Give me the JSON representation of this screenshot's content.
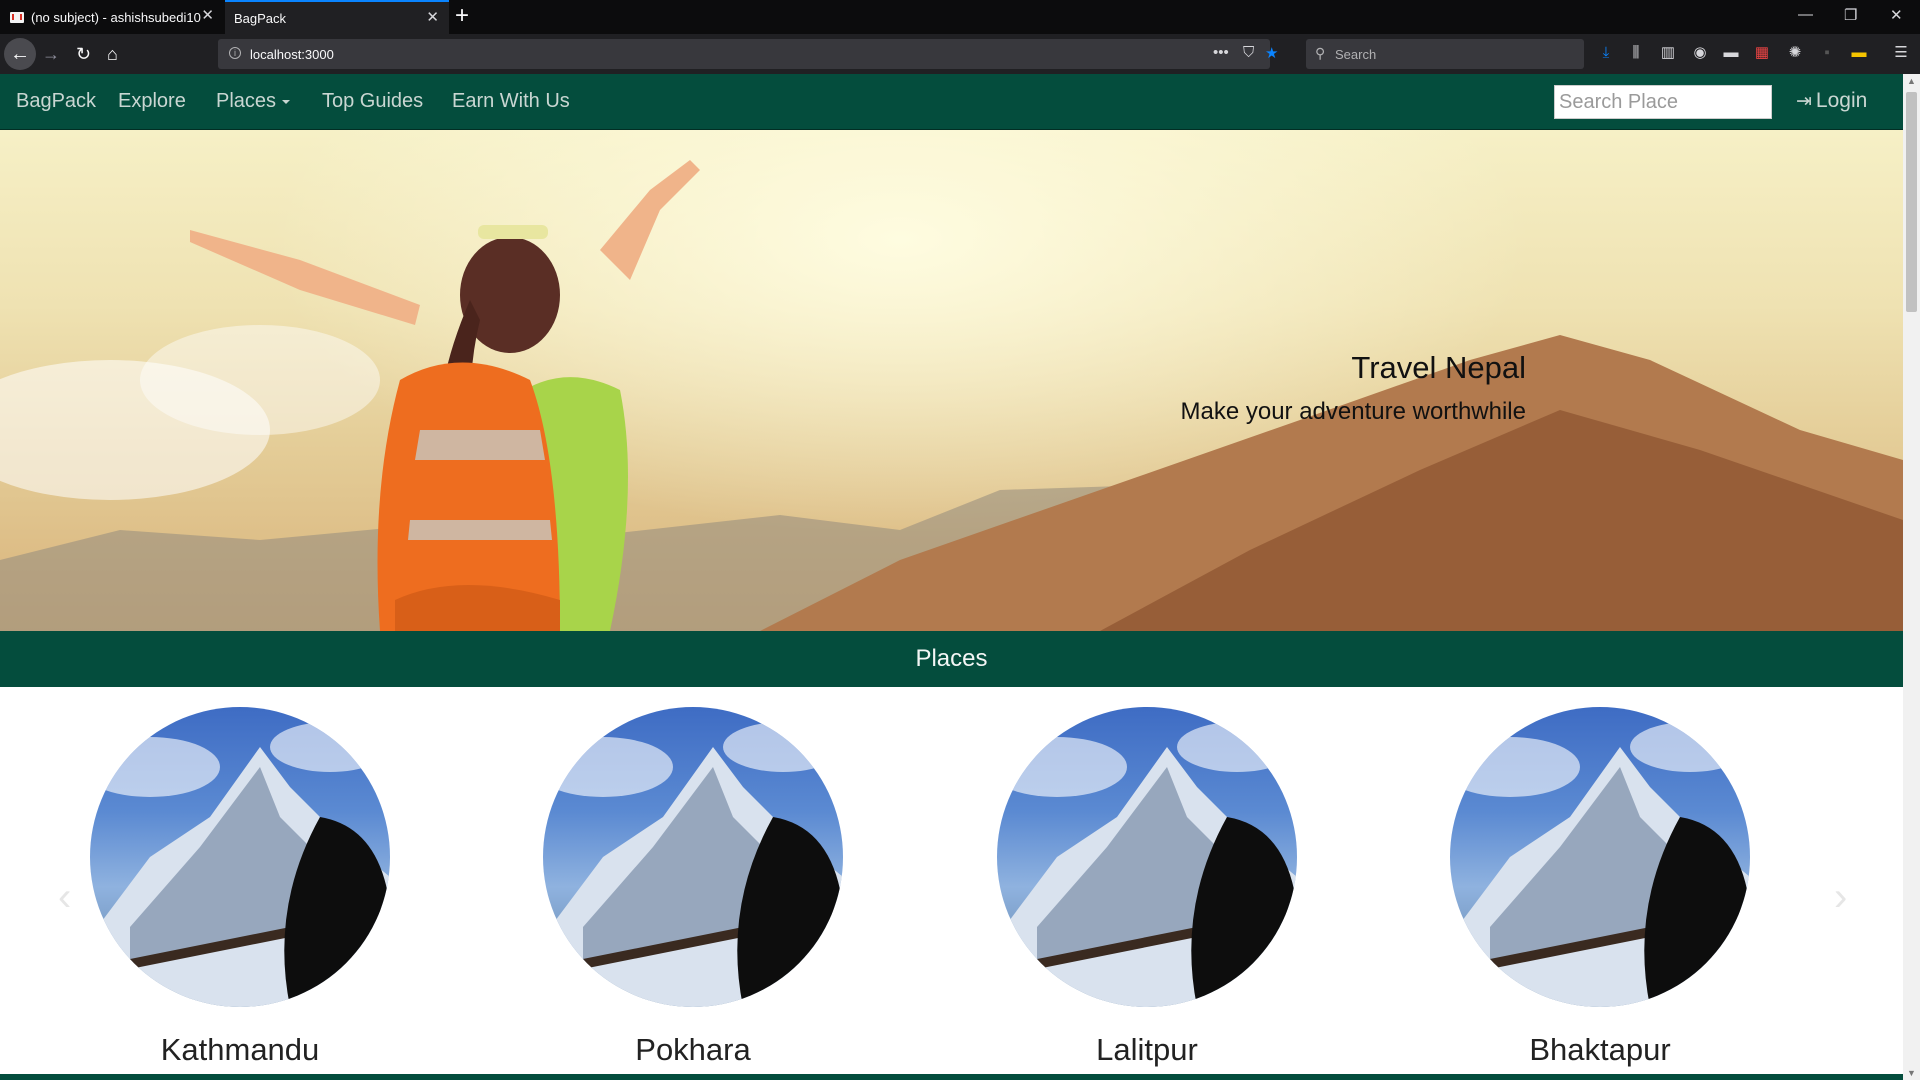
{
  "browser": {
    "tabs": [
      {
        "title": "(no subject) - ashishsubedi10@",
        "active": false
      },
      {
        "title": "BagPack",
        "active": true
      }
    ],
    "url": "localhost:3000",
    "search_placeholder": "Search"
  },
  "site": {
    "nav": {
      "brand": "BagPack",
      "links": [
        "Explore",
        "Places",
        "Top Guides",
        "Earn With Us"
      ],
      "search_placeholder": "Search Place",
      "login_label": "Login"
    },
    "hero": {
      "title": "Travel Nepal",
      "subtitle": "Make your adventure worthwhile"
    },
    "places": {
      "heading": "Places",
      "items": [
        "Kathmandu",
        "Pokhara",
        "Lalitpur",
        "Bhaktapur"
      ]
    }
  },
  "colors": {
    "brand_green": "#044d3d",
    "browser_accent": "#0a84ff"
  },
  "icons": [
    "back-arrow-icon",
    "forward-arrow-icon",
    "reload-icon",
    "home-icon",
    "login-icon",
    "carousel-prev-icon",
    "carousel-next-icon"
  ]
}
